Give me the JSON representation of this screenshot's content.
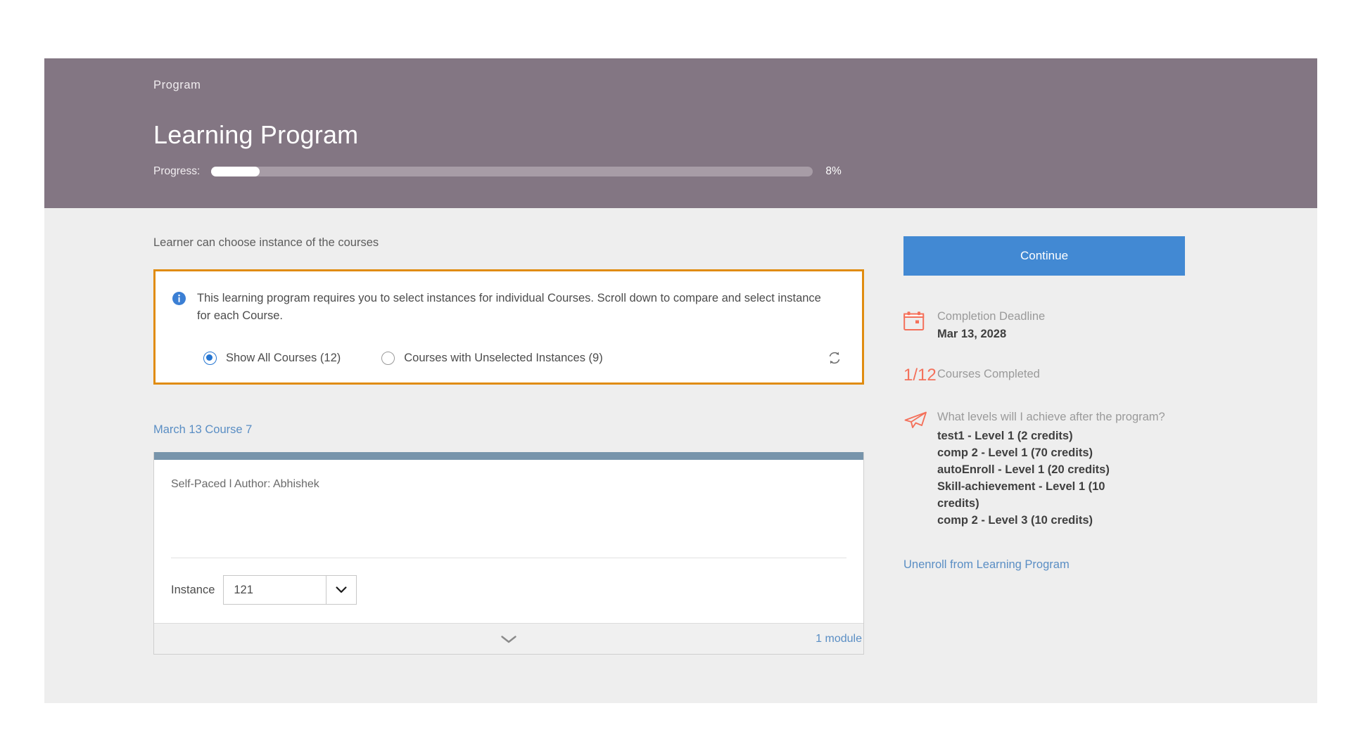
{
  "header": {
    "breadcrumb": "Program",
    "title": "Learning Program",
    "progress_label": "Progress:",
    "progress_percent_text": "8%",
    "progress_percent_value": 8,
    "bg_color": "#837683"
  },
  "main": {
    "lead_text": "Learner can choose instance of the courses",
    "info_box": {
      "icon": "info-icon",
      "message": "This learning program requires you to select instances for individual Courses. Scroll down to compare and select instance for each Course.",
      "border_color": "#e08c10",
      "options": [
        {
          "label": "Show All Courses (12)",
          "selected": true
        },
        {
          "label": "Courses with Unselected Instances (9)",
          "selected": false
        }
      ],
      "refresh_icon": "refresh-icon"
    },
    "course": {
      "title": "March 13 Course 7",
      "meta": "Self-Paced l Author: Abhishek",
      "instance_label": "Instance",
      "instance_value": "121",
      "modules_label": "1 module",
      "topbar_color": "#7794ab"
    }
  },
  "sidebar": {
    "continue_label": "Continue",
    "continue_color": "#4289d3",
    "deadline": {
      "icon": "calendar-icon",
      "caption": "Completion Deadline",
      "value": "Mar 13, 2028"
    },
    "courses_completed": {
      "count": "1/12",
      "caption": "Courses Completed",
      "count_color": "#f4705a"
    },
    "levels": {
      "icon": "paper-plane-icon",
      "question": "What levels will I achieve after the program?",
      "items": [
        "test1 - Level 1 (2 credits)",
        "comp 2 - Level 1 (70 credits)",
        "autoEnroll - Level 1 (20 credits)",
        "Skill-achievement - Level 1 (10 credits)",
        "comp 2 - Level 3 (10 credits)"
      ]
    },
    "unenroll_label": "Unenroll from Learning Program"
  }
}
